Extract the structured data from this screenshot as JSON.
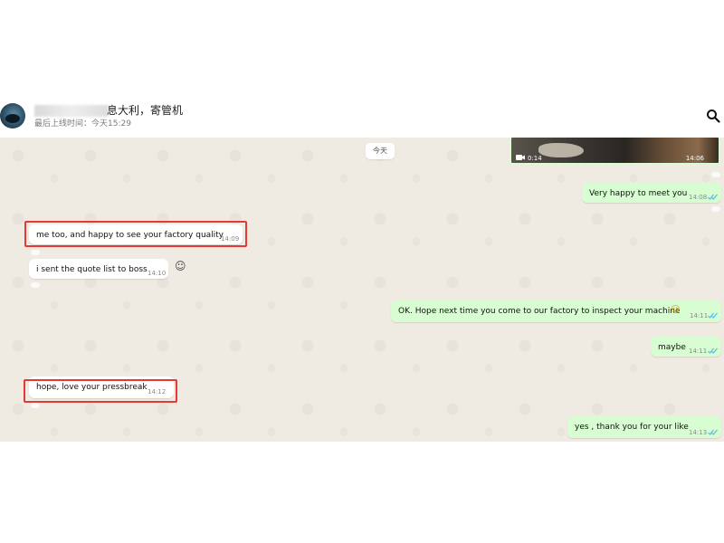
{
  "header": {
    "contact_name": "息大利，寄管机",
    "last_seen": "最后上线时间：今天15:29"
  },
  "chat": {
    "date_chip": "今天",
    "media": {
      "duration": "0:14",
      "time": "14:06"
    },
    "messages": [
      {
        "text": "Very happy to meet you",
        "time": "14:08"
      },
      {
        "text": "me too, and happy to see your factory quality",
        "time": "14:09"
      },
      {
        "text": "i sent the quote list to boss",
        "time": "14:10"
      },
      {
        "text": "OK. Hope next time you come to our factory to inspect your machine",
        "time": "14:11"
      },
      {
        "text": "maybe",
        "time": "14:11"
      },
      {
        "text": "hope, love your pressbreak",
        "time": "14:12"
      },
      {
        "text": "yes , thank you for your like",
        "time": "14:13"
      }
    ],
    "emoji_inline": "☺",
    "reaction_icon": "☺"
  },
  "colors": {
    "outgoing": "#d9fdd3",
    "incoming": "#ffffff",
    "highlight": "#e53935",
    "read_tick": "#53bdeb"
  }
}
